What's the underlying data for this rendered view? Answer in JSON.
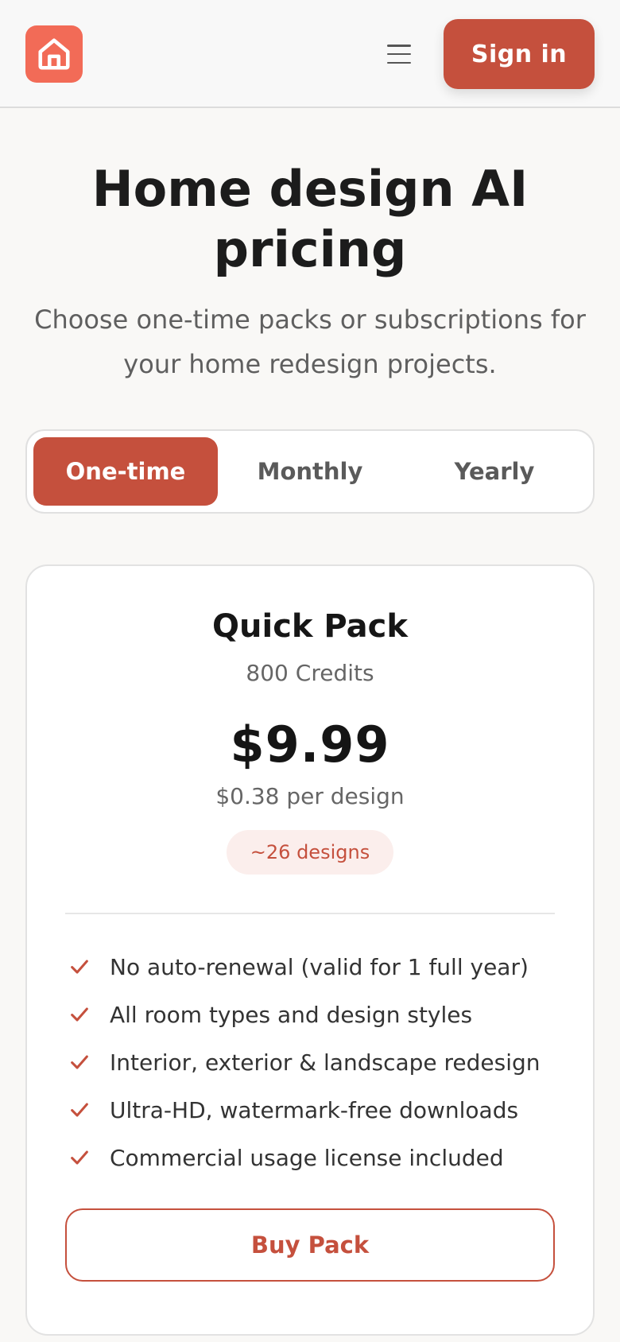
{
  "header": {
    "logo_icon": "home-icon",
    "menu_icon": "hamburger-menu-icon",
    "signin_label": "Sign in"
  },
  "hero": {
    "title": "Home design AI pricing",
    "subtitle": "Choose one-time packs or subscriptions for your home redesign projects."
  },
  "billing_toggle": {
    "options": [
      "One-time",
      "Monthly",
      "Yearly"
    ],
    "selected": "One-time"
  },
  "plan": {
    "name": "Quick Pack",
    "credits": "800 Credits",
    "price": "$9.99",
    "per_design": "$0.38 per design",
    "badge": "~26 designs",
    "features": [
      "No auto-renewal (valid for 1 full year)",
      "All room types and design styles",
      "Interior, exterior & landscape redesign",
      "Ultra-HD, watermark-free downloads",
      "Commercial usage license included"
    ],
    "cta_label": "Buy Pack"
  },
  "colors": {
    "accent": "#c5503d",
    "logo_bg": "#f26b57",
    "page_bg": "#f9f8f6"
  }
}
